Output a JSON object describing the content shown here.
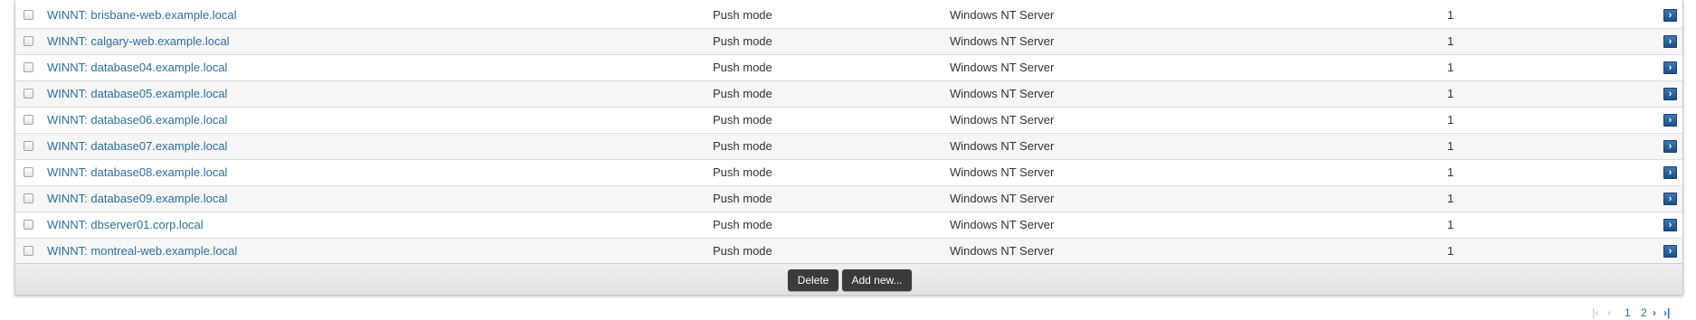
{
  "table": {
    "rows": [
      {
        "name": "WINNT: brisbane-web.example.local",
        "mode": "Push mode",
        "os": "Windows NT Server",
        "count": "1"
      },
      {
        "name": "WINNT: calgary-web.example.local",
        "mode": "Push mode",
        "os": "Windows NT Server",
        "count": "1"
      },
      {
        "name": "WINNT: database04.example.local",
        "mode": "Push mode",
        "os": "Windows NT Server",
        "count": "1"
      },
      {
        "name": "WINNT: database05.example.local",
        "mode": "Push mode",
        "os": "Windows NT Server",
        "count": "1"
      },
      {
        "name": "WINNT: database06.example.local",
        "mode": "Push mode",
        "os": "Windows NT Server",
        "count": "1"
      },
      {
        "name": "WINNT: database07.example.local",
        "mode": "Push mode",
        "os": "Windows NT Server",
        "count": "1"
      },
      {
        "name": "WINNT: database08.example.local",
        "mode": "Push mode",
        "os": "Windows NT Server",
        "count": "1"
      },
      {
        "name": "WINNT: database09.example.local",
        "mode": "Push mode",
        "os": "Windows NT Server",
        "count": "1"
      },
      {
        "name": "WINNT: dbserver01.corp.local",
        "mode": "Push mode",
        "os": "Windows NT Server",
        "count": "1"
      },
      {
        "name": "WINNT: montreal-web.example.local",
        "mode": "Push mode",
        "os": "Windows NT Server",
        "count": "1"
      }
    ],
    "row_action_icon": "arrow-right-icon"
  },
  "footer": {
    "delete_label": "Delete",
    "add_label": "Add new..."
  },
  "pagination": {
    "first_icon": "first-page-icon",
    "prev_icon": "prev-page-icon",
    "pages": [
      "1",
      "2"
    ],
    "next_icon": "next-page-icon",
    "last_icon": "last-page-icon"
  },
  "colors": {
    "link": "#2d6f9e",
    "button_bg": "#3a3a3a",
    "action_icon_bg": "#2f64a0"
  }
}
